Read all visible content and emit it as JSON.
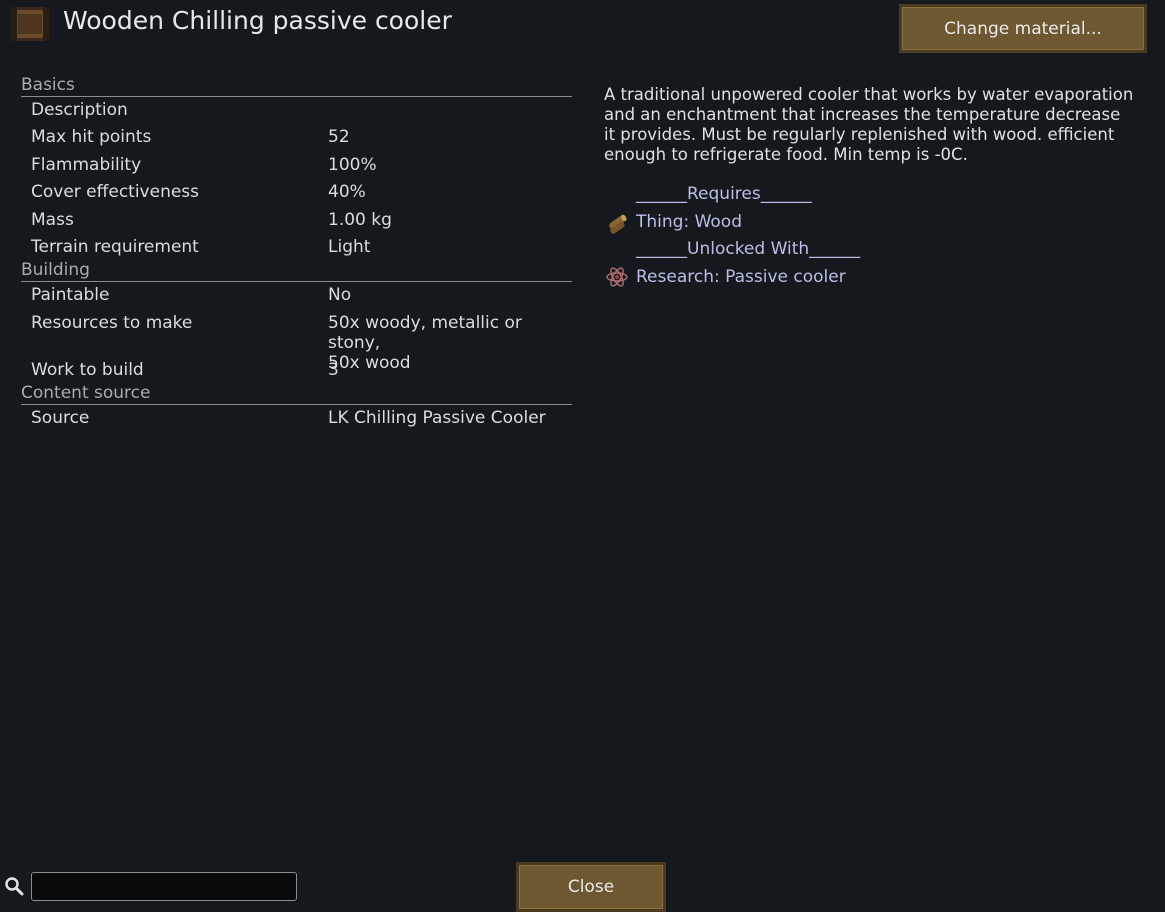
{
  "window": {
    "title": "Wooden Chilling passive cooler",
    "change_material_label": "Change material...",
    "close_label": "Close"
  },
  "stats": {
    "sections": [
      {
        "header": "Basics",
        "rows": [
          {
            "label": "Description",
            "value": ""
          },
          {
            "label": "Max hit points",
            "value": "52"
          },
          {
            "label": "Flammability",
            "value": "100%"
          },
          {
            "label": "Cover effectiveness",
            "value": "40%"
          },
          {
            "label": "Mass",
            "value": "1.00 kg"
          },
          {
            "label": "Terrain requirement",
            "value": "Light"
          }
        ]
      },
      {
        "header": "Building",
        "rows": [
          {
            "label": "Paintable",
            "value": "No"
          },
          {
            "label": "Resources to make",
            "value": "50x woody, metallic or stony,\n50x wood"
          },
          {
            "label": "Work to build",
            "value": "3"
          }
        ]
      },
      {
        "header": "Content source",
        "rows": [
          {
            "label": "Source",
            "value": "LK Chilling Passive Cooler"
          }
        ]
      }
    ]
  },
  "info": {
    "description": "A traditional unpowered cooler that works by water evaporation and an enchantment that increases the temperature decrease it provides. Must be regularly replenished with wood. efficient enough to refrigerate food. Min temp is -0C.",
    "requires_header": "______Requires______",
    "requires_item": "Thing: Wood",
    "unlocked_header": "______Unlocked With______",
    "unlocked_item": "Research: Passive cooler"
  },
  "search": {
    "value": "",
    "placeholder": ""
  },
  "icons": {
    "title": "wooden-cooler-icon",
    "wood": "wood-log-icon",
    "research": "atom-icon",
    "search": "search-icon"
  },
  "colors": {
    "background": "#15191d",
    "button": "#6e5831",
    "link": "#b9bfe6",
    "section_header": "#a9abae"
  }
}
